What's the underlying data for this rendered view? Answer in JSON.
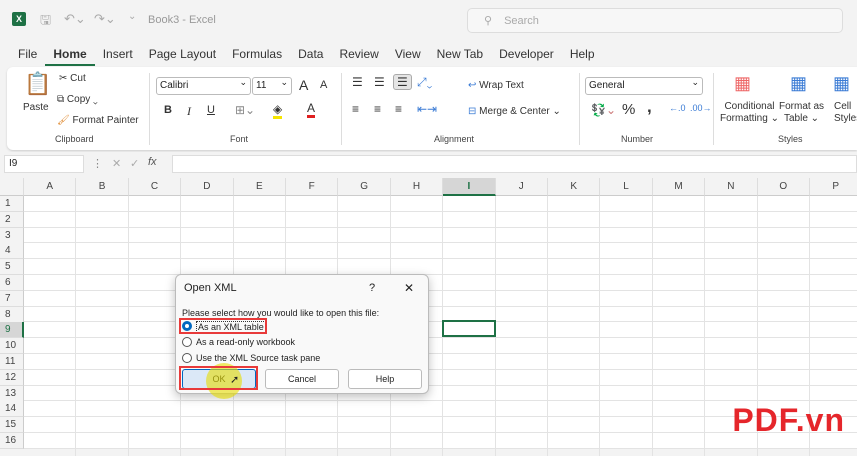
{
  "titlebar": {
    "app_icon": "X",
    "doc_title": "Book3  -  Excel",
    "search_placeholder": "Search"
  },
  "tabs": [
    "File",
    "Home",
    "Insert",
    "Page Layout",
    "Formulas",
    "Data",
    "Review",
    "View",
    "New Tab",
    "Developer",
    "Help"
  ],
  "ribbon": {
    "clipboard": {
      "paste": "Paste",
      "cut": "Cut",
      "copy": "Copy",
      "format_painter": "Format Painter",
      "label": "Clipboard"
    },
    "font": {
      "name": "Calibri",
      "size": "11",
      "bold": "B",
      "italic": "I",
      "underline": "U",
      "label": "Font",
      "grow": "A",
      "shrink": "A",
      "color_letter": "A"
    },
    "alignment": {
      "wrap": "Wrap Text",
      "merge": "Merge & Center",
      "label": "Alignment"
    },
    "number": {
      "format": "General",
      "percent": "%",
      "comma": ",",
      "label": "Number"
    },
    "styles": {
      "conditional": "Conditional",
      "conditional2": "Formatting",
      "format_table": "Format as",
      "format_table2": "Table",
      "cell_styles": "Cell",
      "cell_styles2": "Styles",
      "label": "Styles"
    }
  },
  "formula_bar": {
    "name_box": "I9",
    "formula": "",
    "cancel": "✕",
    "enter": "✓",
    "fx": "fx"
  },
  "grid": {
    "columns": [
      "A",
      "B",
      "C",
      "D",
      "E",
      "F",
      "G",
      "H",
      "I",
      "J",
      "K",
      "L",
      "M",
      "N",
      "O",
      "P"
    ],
    "rows": [
      "1",
      "2",
      "3",
      "4",
      "5",
      "6",
      "7",
      "8",
      "9",
      "10",
      "11",
      "12",
      "13",
      "14",
      "15",
      "16"
    ],
    "selected_column": "I",
    "selected_row": "9"
  },
  "dialog": {
    "title": "Open XML",
    "help": "?",
    "close": "✕",
    "prompt": "Please select how you would like to open this file:",
    "options": [
      "As an XML table",
      "As a read-only workbook",
      "Use the XML Source task pane"
    ],
    "selected": 0,
    "ok": "OK",
    "cancel": "Cancel",
    "help_btn": "Help"
  },
  "watermark": "PDF.vn",
  "colors": {
    "accent": "#1e7145",
    "highlight": "#e83a3a",
    "radio": "#0067c0"
  }
}
